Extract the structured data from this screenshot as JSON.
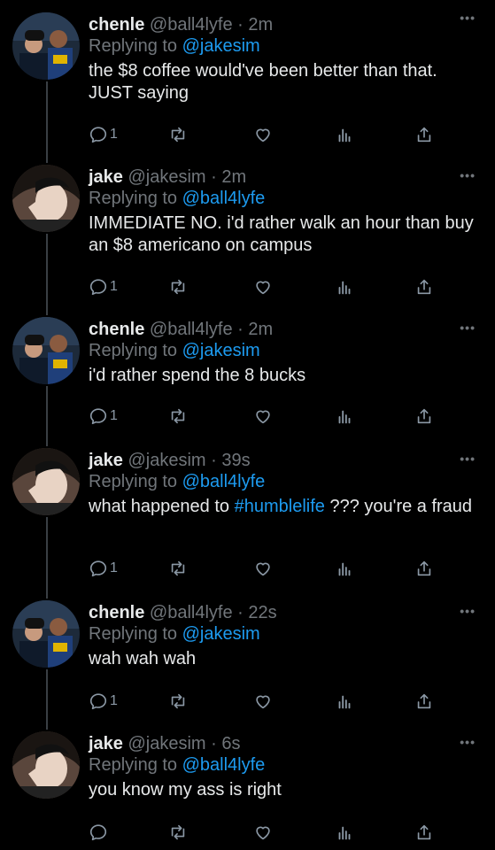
{
  "tweets": [
    {
      "name": "chenle",
      "handle": "@ball4lyfe",
      "time": "2m",
      "reply_label": "Replying to",
      "reply_to": "@jakesim",
      "text_parts": [
        "the $8 coffee would've been better than that. JUST saying"
      ],
      "reply_count": "1",
      "avatar": "chenle"
    },
    {
      "name": "jake",
      "handle": "@jakesim",
      "time": "2m",
      "reply_label": "Replying to",
      "reply_to": "@ball4lyfe",
      "text_parts": [
        "IMMEDIATE NO. i'd rather walk an hour than buy an $8 americano on campus"
      ],
      "reply_count": "1",
      "avatar": "jake"
    },
    {
      "name": "chenle",
      "handle": "@ball4lyfe",
      "time": "2m",
      "reply_label": "Replying to",
      "reply_to": "@jakesim",
      "text_parts": [
        "i'd rather spend the 8 bucks"
      ],
      "reply_count": "1",
      "avatar": "chenle"
    },
    {
      "name": "jake",
      "handle": "@jakesim",
      "time": "39s",
      "reply_label": "Replying to",
      "reply_to": "@ball4lyfe",
      "text_parts": [
        "what happened to ",
        "#humblelife",
        " ??? you're a fraud"
      ],
      "reply_count": "1",
      "avatar": "jake"
    },
    {
      "name": "chenle",
      "handle": "@ball4lyfe",
      "time": "22s",
      "reply_label": "Replying to",
      "reply_to": "@jakesim",
      "text_parts": [
        "wah wah wah"
      ],
      "reply_count": "1",
      "avatar": "chenle"
    },
    {
      "name": "jake",
      "handle": "@jakesim",
      "time": "6s",
      "reply_label": "Replying to",
      "reply_to": "@ball4lyfe",
      "text_parts": [
        "you know my ass is right"
      ],
      "reply_count": "",
      "avatar": "jake"
    }
  ],
  "separator": "·",
  "more_glyph": "•••",
  "colors": {
    "background": "#000000",
    "accent": "#1d9bf0",
    "muted": "#71767b",
    "text": "#e7e9ea"
  }
}
